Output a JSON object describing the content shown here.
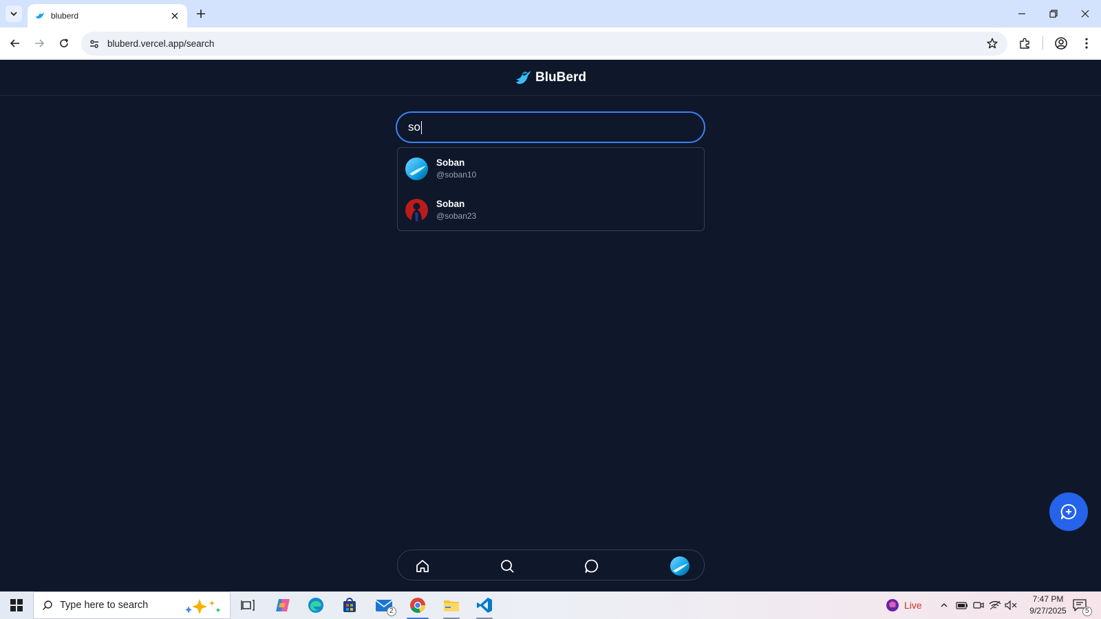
{
  "browser": {
    "tab_title": "bluberd",
    "url": "bluberd.vercel.app/search"
  },
  "app": {
    "brand_name": "BluBerd",
    "search": {
      "value": "so"
    },
    "results": [
      {
        "name": "Soban",
        "handle": "@soban10"
      },
      {
        "name": "Soban",
        "handle": "@soban23"
      }
    ],
    "colors": {
      "background": "#0f172a",
      "accent": "#3b82f6",
      "fab": "#2563eb",
      "border": "#334155"
    }
  },
  "taskbar": {
    "search_placeholder": "Type here to search",
    "mail_badge": "2",
    "weather_label": "Live",
    "time": "7:47 PM",
    "date": "9/27/2025",
    "notification_badge": "5"
  }
}
